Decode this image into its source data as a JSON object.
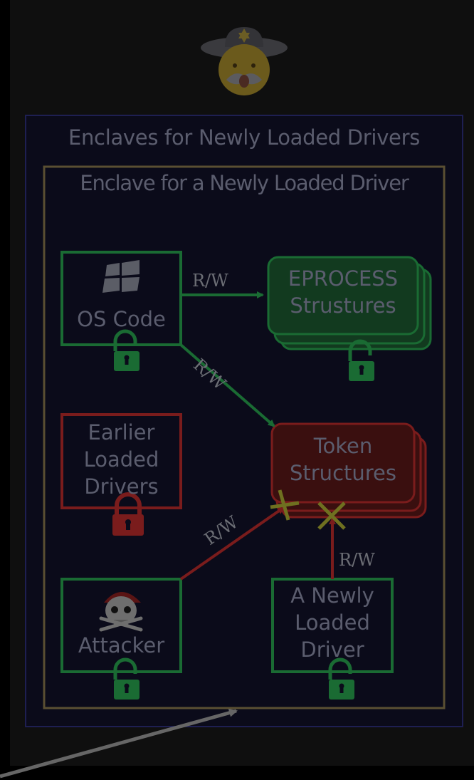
{
  "outer": {
    "title": "Enclaves for Newly Loaded Drivers"
  },
  "inner": {
    "title": "Enclave for a Newly Loaded Driver"
  },
  "nodes": {
    "os_code": {
      "label": "OS Code",
      "icon": "windows-logo-icon",
      "lock": "unlocked"
    },
    "eprocess": {
      "label_line1": "EPROCESS",
      "label_line2": "Strustures",
      "lock": "unlocked"
    },
    "earlier": {
      "line1": "Earlier",
      "line2": "Loaded",
      "line3": "Drivers",
      "lock": "locked"
    },
    "token": {
      "line1": "Token",
      "line2": "Structures"
    },
    "attacker": {
      "label": "Attacker",
      "icon": "pirate-skull-icon",
      "lock": "unlocked"
    },
    "new_driver": {
      "line1": "A Newly",
      "line2": "Loaded",
      "line3": "Driver",
      "lock": "unlocked"
    }
  },
  "edges": {
    "os_to_eprocess": "R/W",
    "os_to_token": "R/W",
    "attacker_to_token": "R/W",
    "new_to_token": "R/W"
  },
  "colors": {
    "background": "#000000",
    "panel": "#0f0f0f",
    "enclave_outer_fill": "#0b0b1a",
    "enclave_outer_border": "#1e1f52",
    "enclave_inner_border": "#5a4f32",
    "trusted_green": "#1a6b33",
    "untrusted_red": "#7a1c1c",
    "denied_mark": "#6f7020",
    "text": "#5b5d6e"
  }
}
